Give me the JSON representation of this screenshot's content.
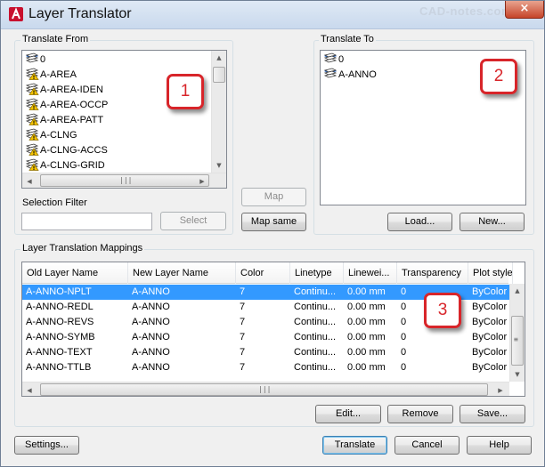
{
  "window": {
    "title": "Layer Translator",
    "watermark": "CAD-notes.com",
    "close_glyph": "×",
    "app_icon": "autocad-a-icon"
  },
  "translate_from": {
    "label": "Translate From",
    "layers": [
      {
        "name": "0",
        "icon": "layer-stack-icon"
      },
      {
        "name": "A-AREA",
        "icon": "layer-warning-icon"
      },
      {
        "name": "A-AREA-IDEN",
        "icon": "layer-warning-icon"
      },
      {
        "name": "A-AREA-OCCP",
        "icon": "layer-warning-icon"
      },
      {
        "name": "A-AREA-PATT",
        "icon": "layer-warning-icon"
      },
      {
        "name": "A-CLNG",
        "icon": "layer-warning-icon"
      },
      {
        "name": "A-CLNG-ACCS",
        "icon": "layer-warning-icon"
      },
      {
        "name": "A-CLNG-GRID",
        "icon": "layer-warning-icon"
      }
    ],
    "selection_filter_label": "Selection Filter",
    "selection_filter_value": "",
    "select_button": "Select"
  },
  "translate_to": {
    "label": "Translate To",
    "layers": [
      {
        "name": "0",
        "icon": "layer-stack-icon"
      },
      {
        "name": "A-ANNO",
        "icon": "layer-stack-icon"
      }
    ],
    "load_button": "Load...",
    "new_button": "New..."
  },
  "middle": {
    "map_button": "Map",
    "map_same_button": "Map same"
  },
  "mappings": {
    "label": "Layer Translation Mappings",
    "columns": [
      "Old Layer Name",
      "New Layer Name",
      "Color",
      "Linetype",
      "Lineweight",
      "Transparency",
      "Plot style"
    ],
    "columns_display": [
      "Old Layer Name",
      "New Layer Name",
      "Color",
      "Linetype",
      "Linewei...",
      "Transparency",
      "Plot style"
    ],
    "rows": [
      {
        "old": "A-ANNO-NPLT",
        "new": "A-ANNO",
        "color": "7",
        "linetype": "Continu...",
        "lineweight": "0.00 mm",
        "transparency": "0",
        "plot_style": "ByColor",
        "selected": true
      },
      {
        "old": "A-ANNO-REDL",
        "new": "A-ANNO",
        "color": "7",
        "linetype": "Continu...",
        "lineweight": "0.00 mm",
        "transparency": "0",
        "plot_style": "ByColor",
        "selected": false
      },
      {
        "old": "A-ANNO-REVS",
        "new": "A-ANNO",
        "color": "7",
        "linetype": "Continu...",
        "lineweight": "0.00 mm",
        "transparency": "0",
        "plot_style": "ByColor",
        "selected": false
      },
      {
        "old": "A-ANNO-SYMB",
        "new": "A-ANNO",
        "color": "7",
        "linetype": "Continu...",
        "lineweight": "0.00 mm",
        "transparency": "0",
        "plot_style": "ByColor",
        "selected": false
      },
      {
        "old": "A-ANNO-TEXT",
        "new": "A-ANNO",
        "color": "7",
        "linetype": "Continu...",
        "lineweight": "0.00 mm",
        "transparency": "0",
        "plot_style": "ByColor",
        "selected": false
      },
      {
        "old": "A-ANNO-TTLB",
        "new": "A-ANNO",
        "color": "7",
        "linetype": "Continu...",
        "lineweight": "0.00 mm",
        "transparency": "0",
        "plot_style": "ByColor",
        "selected": false
      }
    ],
    "edit_button": "Edit...",
    "remove_button": "Remove",
    "save_button": "Save..."
  },
  "footer": {
    "settings_button": "Settings...",
    "translate_button": "Translate",
    "cancel_button": "Cancel",
    "help_button": "Help"
  },
  "callouts": [
    "1",
    "2",
    "3"
  ],
  "colors": {
    "selection": "#3399ff",
    "callout_red": "#d8252a",
    "warning_yellow": "#f5c400"
  }
}
